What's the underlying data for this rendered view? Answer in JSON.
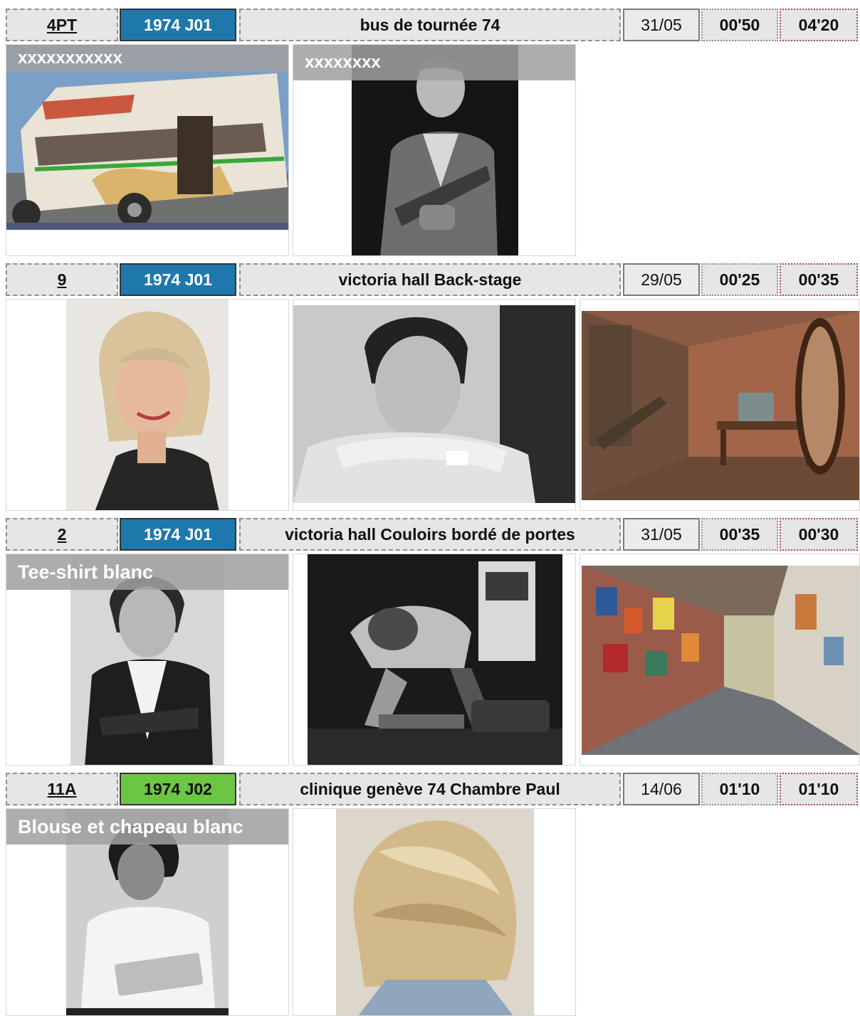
{
  "colors": {
    "episode_blue": "#1f78ac",
    "episode_green": "#6cc644"
  },
  "scenes": [
    {
      "number": "4PT",
      "episode": "1974 J01",
      "episode_color": "blue",
      "title": "bus de tournée 74",
      "date": "31/05",
      "duration": "00'50",
      "time": "04'20",
      "refs": [
        {
          "caption": "xxxxxxxxxxx",
          "picture": "tour bus painted with 'Wings over Europe'"
        },
        {
          "caption": "xxxxxxxx",
          "picture": "singer performing with guitar, black and white"
        }
      ]
    },
    {
      "number": "9",
      "episode": "1974 J01",
      "episode_color": "blue",
      "title": "victoria hall Back-stage",
      "date": "29/05",
      "duration": "00'25",
      "time": "00'35",
      "refs": [
        {
          "caption": "",
          "picture": "blonde woman with bob haircut"
        },
        {
          "caption": "",
          "picture": "young man chin on hands, black and white"
        },
        {
          "caption": "",
          "picture": "backstage room with brick wall, desk, stairs and oval mirror"
        }
      ]
    },
    {
      "number": "2",
      "episode": "1974 J01",
      "episode_color": "blue",
      "title": "victoria hall Couloirs bordé de portes",
      "date": "31/05",
      "duration": "00'35",
      "time": "00'30",
      "refs": [
        {
          "caption": "Tee-shirt blanc",
          "picture": "man in leather jacket and white tee-shirt"
        },
        {
          "caption": "",
          "picture": "musician bent over pedals on stage"
        },
        {
          "caption": "",
          "picture": "corridor with walls covered in posters"
        }
      ]
    },
    {
      "number": "11A",
      "episode": "1974 J02",
      "episode_color": "green",
      "title": "clinique genève 74 Chambre Paul",
      "date": "14/06",
      "duration": "01'10",
      "time": "01'10",
      "refs": [
        {
          "caption": "Blouse et chapeau blanc",
          "picture": "nurse in white blouse holding a clipboard"
        },
        {
          "caption": "",
          "picture": "blonde layered haircut seen from behind"
        }
      ]
    }
  ]
}
